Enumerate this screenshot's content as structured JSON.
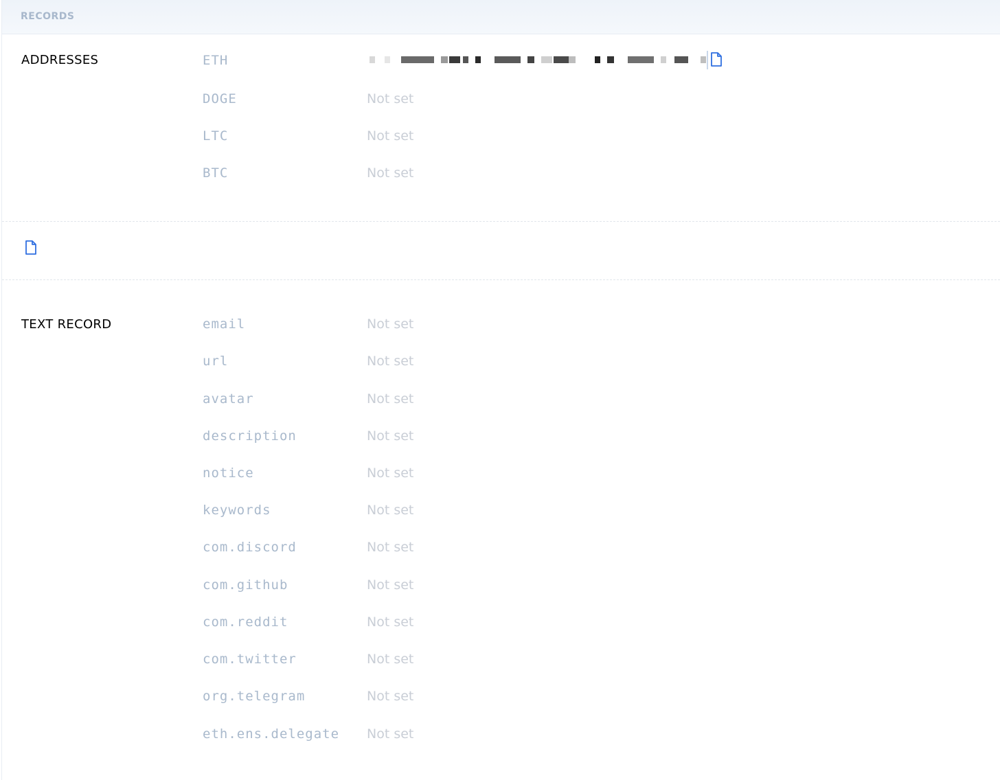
{
  "header": {
    "title": "RECORDS"
  },
  "addresses": {
    "label": "ADDRESSES",
    "items": [
      {
        "key": "ETH",
        "value": ""
      },
      {
        "key": "DOGE",
        "value": "Not set"
      },
      {
        "key": "LTC",
        "value": "Not set"
      },
      {
        "key": "BTC",
        "value": "Not set"
      }
    ]
  },
  "content_hash": {
    "icon": "document-icon"
  },
  "text_record": {
    "label": "TEXT RECORD",
    "items": [
      {
        "key": "email",
        "value": "Not set"
      },
      {
        "key": "url",
        "value": "Not set"
      },
      {
        "key": "avatar",
        "value": "Not set"
      },
      {
        "key": "description",
        "value": "Not set"
      },
      {
        "key": "notice",
        "value": "Not set"
      },
      {
        "key": "keywords",
        "value": "Not set"
      },
      {
        "key": "com.discord",
        "value": "Not set"
      },
      {
        "key": "com.github",
        "value": "Not set"
      },
      {
        "key": "com.reddit",
        "value": "Not set"
      },
      {
        "key": "com.twitter",
        "value": "Not set"
      },
      {
        "key": "org.telegram",
        "value": "Not set"
      },
      {
        "key": "eth.ens.delegate",
        "value": "Not set"
      }
    ]
  },
  "colors": {
    "accent": "#2f6fe0",
    "key_text": "#a9b9cc",
    "not_set": "#c9ced6"
  }
}
